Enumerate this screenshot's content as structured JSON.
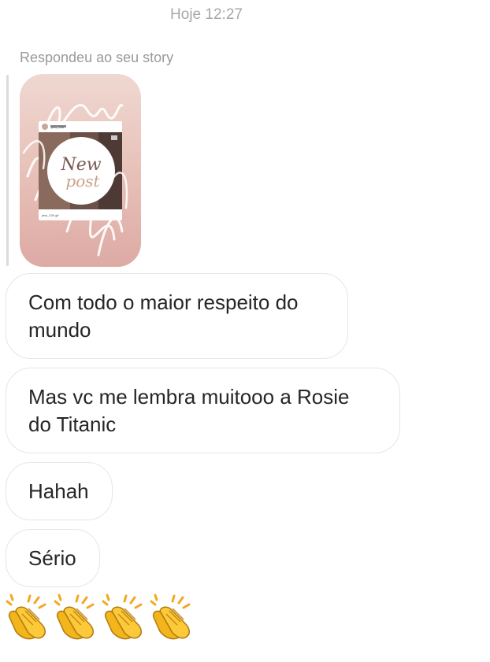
{
  "thread": {
    "timestamp": "Hoje 12:27",
    "story_reply_label": "Respondeu ao seu story"
  },
  "story_preview": {
    "username": "jess_026",
    "overlay_text_line1": "New",
    "overlay_text_line2": "post",
    "caption": "jess_026 gif"
  },
  "messages": [
    {
      "line1": "Com todo o maior respeito do",
      "line2": "mundo"
    },
    {
      "line1": "Mas vc me lembra muitooo a Rosie",
      "line2": "do Titanic"
    },
    {
      "line1": "Hahah"
    },
    {
      "line1": "Sério"
    }
  ],
  "reaction": {
    "icon": "clapping-hands-icon",
    "count": 4
  }
}
